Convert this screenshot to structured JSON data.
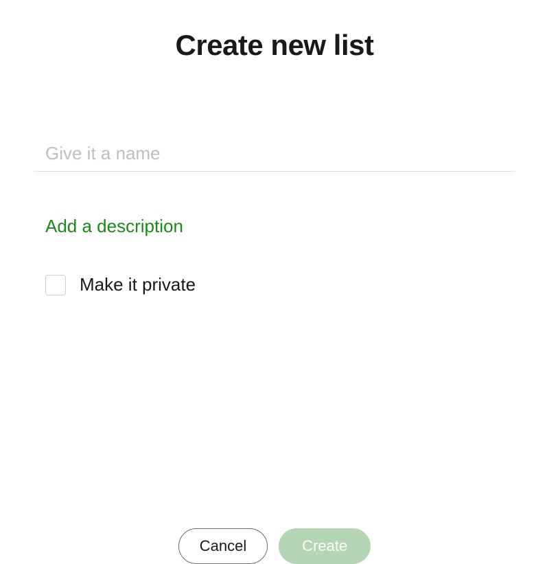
{
  "dialog": {
    "title": "Create new list",
    "name_input": {
      "value": "",
      "placeholder": "Give it a name"
    },
    "add_description_label": "Add a description",
    "private": {
      "label": "Make it private",
      "checked": false
    },
    "buttons": {
      "cancel_label": "Cancel",
      "create_label": "Create"
    }
  }
}
